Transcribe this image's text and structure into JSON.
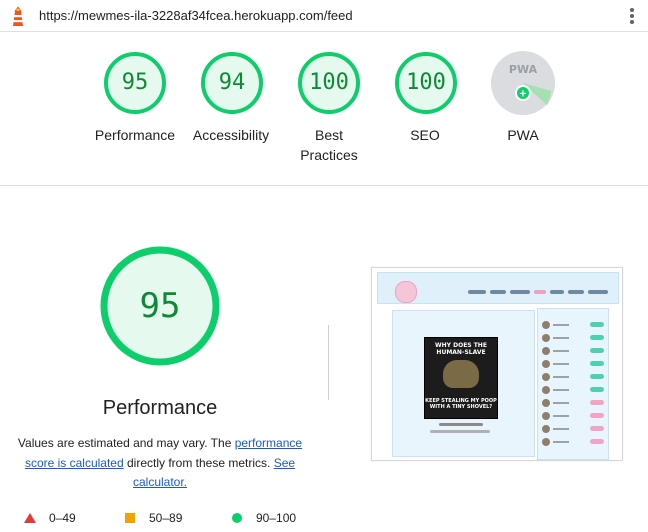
{
  "browser": {
    "url": "https://mewmes-ila-3228af34fcea.herokuapp.com/feed"
  },
  "colors": {
    "pass_green": "#0cce6b",
    "pass_text": "#0c8a35",
    "average_orange": "#f4a200",
    "fail_red": "#e53935",
    "link_blue": "#1a58d4"
  },
  "summary": [
    {
      "label": "Performance",
      "score": 95
    },
    {
      "label": "Accessibility",
      "score": 94
    },
    {
      "label": "Best Practices",
      "score": 100
    },
    {
      "label": "SEO",
      "score": 100
    },
    {
      "label": "PWA",
      "score": null,
      "icon": "pwa-badge-icon"
    }
  ],
  "detail": {
    "score": "95",
    "title": "Performance",
    "desc_prefix": "Values are estimated and may vary. The ",
    "desc_link1": "performance score is calculated",
    "desc_mid": " directly from these metrics. ",
    "desc_link2": "See calculator."
  },
  "legend": [
    {
      "range": "0–49",
      "icon": "fail-triangle-icon"
    },
    {
      "range": "50–89",
      "icon": "average-square-icon"
    },
    {
      "range": "90–100",
      "icon": "pass-circle-icon"
    }
  ],
  "screenshot": {
    "meme_top": "WHY DOES THE HUMAN-SLAVE",
    "meme_bottom": "KEEP STEALING MY POOP WITH A TINY SHOVEL?"
  }
}
